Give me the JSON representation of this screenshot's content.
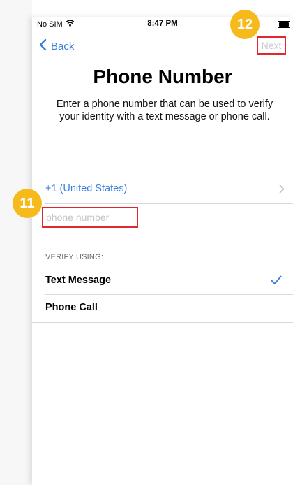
{
  "status_bar": {
    "carrier": "No SIM",
    "time": "8:47 PM"
  },
  "nav": {
    "back_label": "Back",
    "next_label": "Next"
  },
  "header": {
    "title": "Phone Number",
    "subtitle": "Enter a phone number that can be used to verify your identity with a text message or phone call."
  },
  "country": {
    "label": "+1 (United States)"
  },
  "phone_field": {
    "value": "",
    "placeholder": "phone number"
  },
  "verify": {
    "header": "VERIFY USING:",
    "options": [
      {
        "label": "Text Message",
        "selected": true
      },
      {
        "label": "Phone Call",
        "selected": false
      }
    ]
  },
  "annotations": {
    "step_11": "11",
    "step_12": "12"
  },
  "colors": {
    "accent": "#3a7fe0",
    "annotation_badge": "#f6ba1d",
    "highlight_box": "#e0282e"
  }
}
